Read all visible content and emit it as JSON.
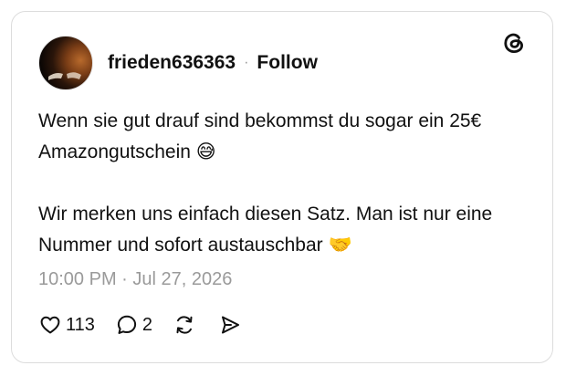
{
  "post": {
    "username": "frieden636363",
    "separator": "·",
    "follow_label": "Follow",
    "paragraphs": [
      "Wenn sie gut drauf sind bekommst du sogar ein 25€ Amazongutschein 😅",
      "Wir merken uns einfach diesen Satz. Man ist nur eine Nummer und sofort austauschbar 🤝"
    ],
    "timestamp": "10:00 PM · Jul 27, 2026",
    "likes": "113",
    "replies": "2",
    "icons": {
      "brand": "threads-logo-icon",
      "like": "heart-icon",
      "reply": "comment-bubble-icon",
      "repost": "repost-icon",
      "share": "share-send-icon"
    }
  }
}
